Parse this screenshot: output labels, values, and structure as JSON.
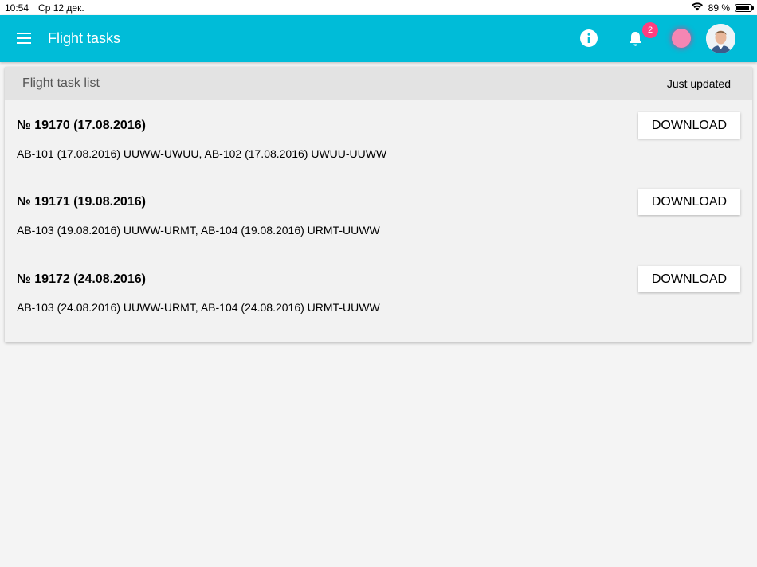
{
  "status_bar": {
    "time": "10:54",
    "date": "Ср 12 дек.",
    "battery": "89 %",
    "battery_level": 0.89
  },
  "app_bar": {
    "title": "Flight tasks",
    "notification_count": "2",
    "background_color": "#00bcd8",
    "badge_color": "#ff3f80"
  },
  "card": {
    "title": "Flight task list",
    "status": "Just updated"
  },
  "tasks": [
    {
      "title": "№ 19170 (17.08.2016)",
      "route": "AB-101 (17.08.2016) UUWW-UWUU, AB-102 (17.08.2016) UWUU-UUWW",
      "button": "DOWNLOAD"
    },
    {
      "title": "№ 19171 (19.08.2016)",
      "route": "AB-103 (19.08.2016) UUWW-URMT, AB-104 (19.08.2016) URMT-UUWW",
      "button": "DOWNLOAD"
    },
    {
      "title": "№ 19172 (24.08.2016)",
      "route": "AB-103 (24.08.2016) UUWW-URMT, AB-104 (24.08.2016) URMT-UUWW",
      "button": "DOWNLOAD"
    }
  ]
}
